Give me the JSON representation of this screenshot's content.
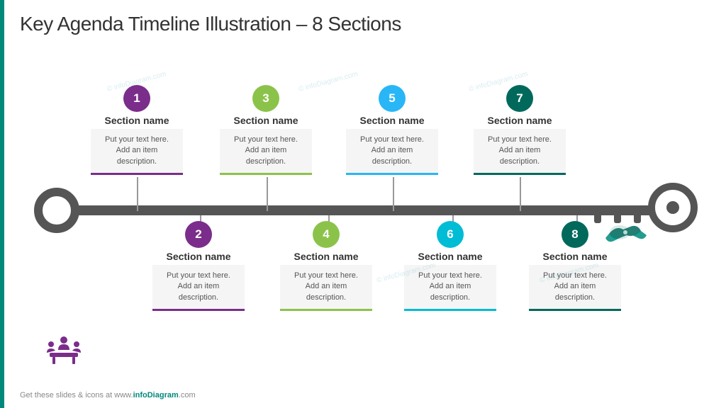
{
  "title": "Key Agenda Timeline Illustration – 8 Sections",
  "sections": [
    {
      "id": 1,
      "number": "1",
      "name": "Section name",
      "description": "Put your text here. Add an item description.",
      "color": "#7B2D8B",
      "position": "top"
    },
    {
      "id": 2,
      "number": "2",
      "name": "Section name",
      "description": "Put your text here. Add an item description.",
      "color": "#7B2D8B",
      "position": "bottom"
    },
    {
      "id": 3,
      "number": "3",
      "name": "Section name",
      "description": "Put your text here. Add an item description.",
      "color": "#8BC34A",
      "position": "top"
    },
    {
      "id": 4,
      "number": "4",
      "name": "Section name",
      "description": "Put your text here. Add an item description.",
      "color": "#8BC34A",
      "position": "bottom"
    },
    {
      "id": 5,
      "number": "5",
      "name": "Section name",
      "description": "Put your text here. Add an item description.",
      "color": "#29B6F6",
      "position": "top"
    },
    {
      "id": 6,
      "number": "6",
      "name": "Section name",
      "description": "Put your text here. Add an item description.",
      "color": "#00BCD4",
      "position": "bottom"
    },
    {
      "id": 7,
      "number": "7",
      "name": "Section name",
      "description": "Put your text here. Add an item description.",
      "color": "#00695C",
      "position": "top"
    },
    {
      "id": 8,
      "number": "8",
      "name": "Section name",
      "description": "Put your text here. Add an item description.",
      "color": "#00695C",
      "position": "bottom"
    }
  ],
  "footer": {
    "text": "Get these slides & icons at www.",
    "brand": "infoDiagram",
    "suffix": ".com"
  }
}
